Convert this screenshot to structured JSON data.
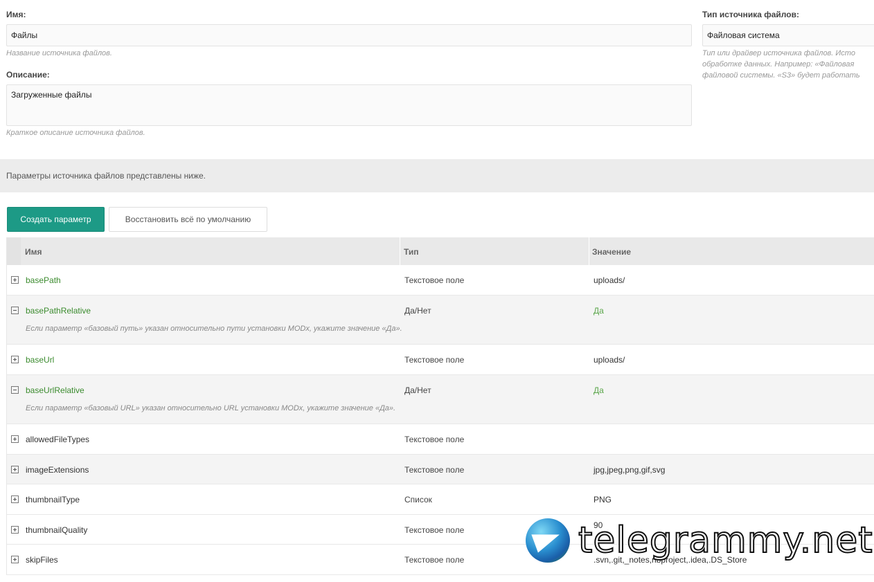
{
  "form": {
    "name_label": "Имя:",
    "name_value": "Файлы",
    "name_hint": "Название источника файлов.",
    "desc_label": "Описание:",
    "desc_value": "Загруженные файлы",
    "desc_hint": "Краткое описание источника файлов.",
    "type_label": "Тип источника файлов:",
    "type_value": "Файловая система",
    "type_hint_1": "Тип или драйвер источника файлов. Исто",
    "type_hint_2": "обработке данных. Например: «Файловая",
    "type_hint_3": "файловой системы. «S3» будет работать"
  },
  "notice": "Параметры источника файлов представлены ниже.",
  "toolbar": {
    "create_label": "Создать параметр",
    "reset_label": "Восстановить всё по умолчанию"
  },
  "grid": {
    "headers": {
      "name": "Имя",
      "type": "Тип",
      "value": "Значение"
    },
    "rows": [
      {
        "name": "basePath",
        "type": "Текстовое поле",
        "value": "uploads/"
      },
      {
        "name": "basePathRelative",
        "type": "Да/Нет",
        "value": "Да",
        "desc": "Если параметр «базовый путь» указан относительно пути установки MODx, укажите значение «Да»."
      },
      {
        "name": "baseUrl",
        "type": "Текстовое поле",
        "value": "uploads/"
      },
      {
        "name": "baseUrlRelative",
        "type": "Да/Нет",
        "value": "Да",
        "desc": "Если параметр «базовый URL» указан относительно URL установки MODx, укажите значение «Да»."
      },
      {
        "name": "allowedFileTypes",
        "type": "Текстовое поле",
        "value": ""
      },
      {
        "name": "imageExtensions",
        "type": "Текстовое поле",
        "value": "jpg,jpeg,png,gif,svg"
      },
      {
        "name": "thumbnailType",
        "type": "Список",
        "value": "PNG"
      },
      {
        "name": "thumbnailQuality",
        "type": "Текстовое поле",
        "value": "90"
      },
      {
        "name": "skipFiles",
        "type": "Текстовое поле",
        "value": ".svn,.git,_notes,nbproject,.idea,.DS_Store"
      }
    ]
  },
  "watermark": {
    "text": "telegrammy.net"
  }
}
